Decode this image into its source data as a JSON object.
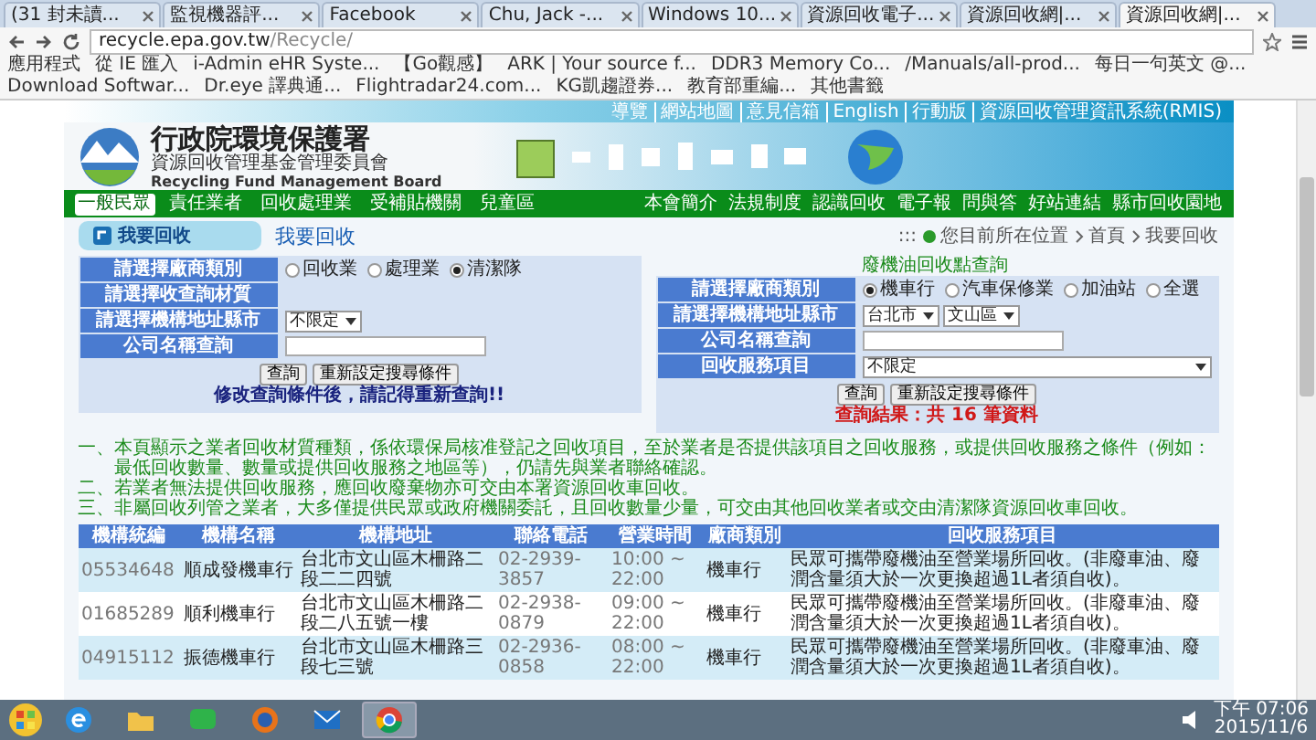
{
  "browser": {
    "tabs": [
      {
        "title": "(31 封未讀...",
        "selected": false
      },
      {
        "title": "監視機器評...",
        "selected": false
      },
      {
        "title": "Facebook",
        "selected": false
      },
      {
        "title": "Chu, Jack -...",
        "selected": false
      },
      {
        "title": "Windows 10...",
        "selected": false
      },
      {
        "title": "資源回收電子...",
        "selected": false
      },
      {
        "title": "資源回收網|...",
        "selected": false
      },
      {
        "title": "資源回收網|...",
        "selected": true
      }
    ],
    "url_host": "recycle.epa.gov.tw",
    "url_path": "/Recycle/",
    "bookmarks": [
      "應用程式",
      "從 IE 匯入",
      "i-Admin eHR Syste...",
      "【Go觀感】",
      "ARK | Your source f...",
      "DDR3 Memory Co...",
      "/Manuals/all-prod...",
      "每日一句英文 @...",
      "Download Softwar...",
      "Dr.eye 譯典通...",
      "Flightradar24.com...",
      "KG凱趨證券...",
      "教育部重編...",
      "其他書籤"
    ]
  },
  "site": {
    "top_links": [
      "導覽",
      "網站地圖",
      "意見信箱",
      "English",
      "行動版",
      "資源回收管理資訊系統(RMIS)"
    ],
    "org_name": "行政院環境保護署",
    "org_subname": "資源回收管理基金管理委員會",
    "org_english": "Recycling Fund Management Board",
    "audience_nav": [
      {
        "label": "一般民眾",
        "selected": true
      },
      {
        "label": "責任業者",
        "selected": false
      },
      {
        "label": "回收處理業",
        "selected": false
      },
      {
        "label": "受補貼機關",
        "selected": false
      },
      {
        "label": "兒童區",
        "selected": false
      }
    ],
    "main_nav": [
      "本會簡介",
      "法規制度",
      "認識回收",
      "電子報",
      "問與答",
      "好站連結",
      "縣市回收園地"
    ]
  },
  "sidebar": {
    "title": "我要回收"
  },
  "breadcrumb": {
    "prefix": ":::",
    "items": [
      "您目前所在位置",
      "首頁",
      "我要回收"
    ]
  },
  "page_title": "我要回收",
  "search_form": {
    "rows": [
      {
        "label": "請選擇廠商類別",
        "kind": "radios",
        "options": [
          {
            "label": "回收業",
            "selected": false
          },
          {
            "label": "處理業",
            "selected": false
          },
          {
            "label": "清潔隊",
            "selected": true
          }
        ]
      },
      {
        "label": "請選擇收查詢材質",
        "kind": "empty"
      },
      {
        "label": "請選擇機構地址縣市",
        "kind": "selects",
        "selects": [
          "不限定"
        ]
      },
      {
        "label": "公司名稱查詢",
        "kind": "input"
      }
    ],
    "buttons": [
      "查詢",
      "重新設定搜尋條件"
    ],
    "hint": "修改查詢條件後，請記得重新查詢!!"
  },
  "oil_form": {
    "heading": "廢機油回收點查詢",
    "rows": [
      {
        "label": "請選擇廠商類別",
        "kind": "radios",
        "options": [
          {
            "label": "機車行",
            "selected": true
          },
          {
            "label": "汽車保修業",
            "selected": false
          },
          {
            "label": "加油站",
            "selected": false
          },
          {
            "label": "全選",
            "selected": false
          }
        ]
      },
      {
        "label": "請選擇機構地址縣市",
        "kind": "selects",
        "selects": [
          "台北市",
          "文山區"
        ]
      },
      {
        "label": "公司名稱查詢",
        "kind": "input"
      },
      {
        "label": "回收服務項目",
        "kind": "selects",
        "selects": [
          "不限定"
        ]
      }
    ],
    "buttons": [
      "查詢",
      "重新設定搜尋條件"
    ],
    "result": "查詢結果：共 16 筆資料"
  },
  "notes": [
    {
      "number": "一、",
      "text": "本頁顯示之業者回收材質種類，係依環保局核准登記之回收項目，至於業者是否提供該項目之回收服務，或提供回收服務之條件（例如：最低回收數量、數量或提供回收服務之地區等），仍請先與業者聯絡確認。"
    },
    {
      "number": "二、",
      "text": "若業者無法提供回收服務，應回收廢棄物亦可交由本署資源回收車回收。"
    },
    {
      "number": "三、",
      "text": "非屬回收列管之業者，大多僅提供民眾或政府機關委託，且回收數量少量，可交由其他回收業者或交由清潔隊資源回收車回收。"
    }
  ],
  "table": {
    "columns": [
      "機構統編",
      "機構名稱",
      "機構地址",
      "聯絡電話",
      "營業時間",
      "廠商類別",
      "回收服務項目"
    ],
    "rows": [
      [
        "05534648",
        "順成發機車行",
        "台北市文山區木柵路二段二二四號",
        "02-2939-3857",
        "10:00 ~ 22:00",
        "機車行",
        "民眾可攜帶廢機油至營業場所回收。(非廢車油、廢潤含量須大於一次更換超過1L者須自收)。"
      ],
      [
        "01685289",
        "順利機車行",
        "台北市文山區木柵路二段二八五號一樓",
        "02-2938-0879",
        "09:00 ~ 22:00",
        "機車行",
        "民眾可攜帶廢機油至營業場所回收。(非廢車油、廢潤含量須大於一次更換超過1L者須自收)。"
      ],
      [
        "04915112",
        "振德機車行",
        "台北市文山區木柵路三段七三號",
        "02-2936-0858",
        "08:00 ~ 22:00",
        "機車行",
        "民眾可攜帶廢機油至營業場所回收。(非廢車油、廢潤含量須大於一次更換超過1L者須自收)。"
      ]
    ]
  },
  "taskbar": {
    "apps": [
      {
        "kind": "ie",
        "active": false
      },
      {
        "kind": "folder",
        "active": false
      },
      {
        "kind": "chat",
        "active": false
      },
      {
        "kind": "firefox",
        "active": false
      },
      {
        "kind": "mail",
        "active": false
      },
      {
        "kind": "chrome",
        "active": true
      }
    ],
    "time": "下午 07:06",
    "date": "2015/11/6"
  }
}
